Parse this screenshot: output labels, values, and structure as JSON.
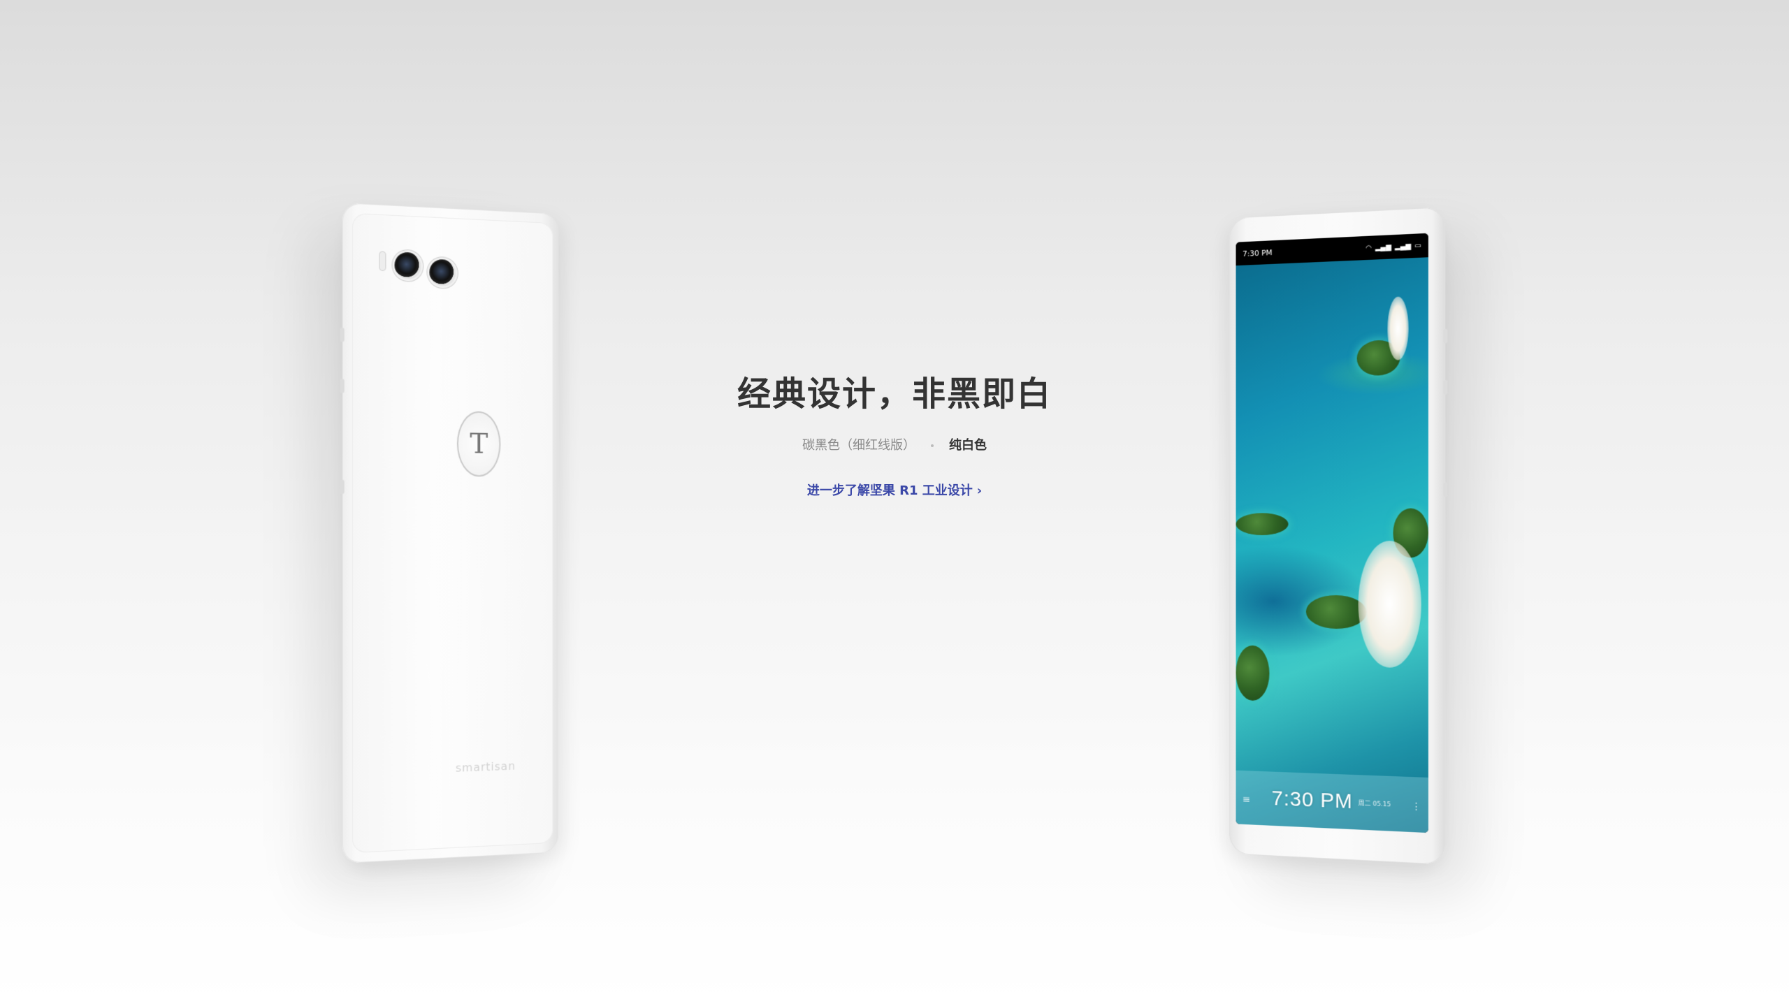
{
  "hero": {
    "headline": "经典设计，非黑即白",
    "color_options": [
      {
        "label": "碳黑色（细红线版）",
        "active": false
      },
      {
        "label": "纯白色",
        "active": true
      }
    ],
    "learn_more": "进一步了解坚果 R1 工业设计",
    "learn_more_chevron": "›"
  },
  "back_phone": {
    "logo_glyph": "T",
    "brand": "smartisan"
  },
  "front_phone": {
    "status_time": "7:30 PM",
    "status_icons": [
      "wifi-icon",
      "signal-icon",
      "signal-icon",
      "battery-icon"
    ],
    "clock": "7:30 PM",
    "date": "周二 05.15"
  },
  "colors": {
    "link": "#3b48a8",
    "headline": "#333333",
    "muted": "#888888"
  }
}
